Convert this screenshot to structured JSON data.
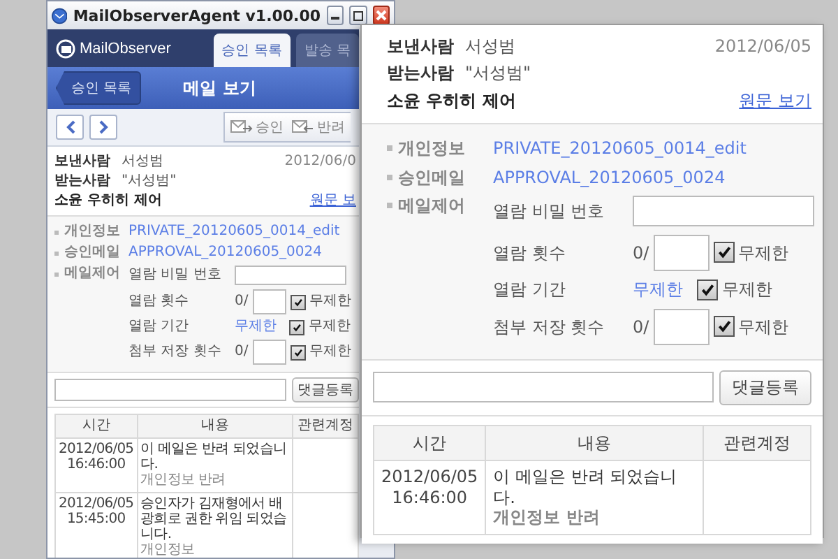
{
  "window": {
    "title": "MailObserverAgent v1.00.00",
    "logo": "MailObserver",
    "tabs": [
      {
        "label": "승인 목록",
        "selected": true
      },
      {
        "label": "발송 목",
        "selected": false
      }
    ],
    "back_button": "승인 목록",
    "page_title": "메일 보기",
    "toolbar": {
      "buttons": [
        {
          "kind": "approve",
          "label": "승인"
        },
        {
          "kind": "reject",
          "label": "반려"
        }
      ]
    },
    "mail": {
      "sender_label": "보낸사람",
      "sender": "서성범",
      "date": "2012/06/0",
      "recipient_label": "받는사람",
      "recipient": "\"서성범\"",
      "subject": "소윤 우히히 제어",
      "original_link": "원문 보",
      "private_label": "개인정보",
      "private_value": "PRIVATE_20120605_0014_edit",
      "approval_label": "승인메일",
      "approval_value": "APPROVAL_20120605_0024",
      "control_label": "메일제어",
      "controls": [
        {
          "kind": "password",
          "label": "열람 비밀 번호"
        },
        {
          "kind": "count",
          "label": "열람 횟수",
          "prefix": "0/",
          "checkbox_label": "무제한",
          "checked": true
        },
        {
          "kind": "period",
          "label": "열람 기간",
          "value": "무제한",
          "checkbox_label": "무제한",
          "checked": true
        },
        {
          "kind": "count",
          "label": "첨부 저장 횟수",
          "prefix": "0/",
          "checkbox_label": "무제한",
          "checked": true
        }
      ],
      "comment_button": "댓글등록",
      "columns": [
        "시간",
        "내용",
        "관련계정"
      ],
      "rows": [
        {
          "date": "2012/06/05",
          "time": "16:46:00",
          "message": "이 메일은 반려 되었습니다.",
          "tag": "개인정보 반려"
        },
        {
          "date": "2012/06/05",
          "time": "15:45:00",
          "message": "승인자가 김재형에서 배광희로 권한 위임 되었습니다.",
          "tag": "개인정보"
        }
      ]
    }
  },
  "callout": {
    "mail": {
      "sender_label": "보낸사람",
      "sender": "서성범",
      "date": "2012/06/05",
      "recipient_label": "받는사람",
      "recipient": "\"서성범\"",
      "subject": "소윤 우히히 제어",
      "original_link": "원문 보기",
      "private_label": "개인정보",
      "private_value": "PRIVATE_20120605_0014_edit",
      "approval_label": "승인메일",
      "approval_value": "APPROVAL_20120605_0024",
      "control_label": "메일제어",
      "controls": [
        {
          "kind": "password",
          "label": "열람 비밀 번호"
        },
        {
          "kind": "count",
          "label": "열람 횟수",
          "prefix": "0/",
          "checkbox_label": "무제한",
          "checked": true
        },
        {
          "kind": "period",
          "label": "열람 기간",
          "value": "무제한",
          "checkbox_label": "무제한",
          "checked": true
        },
        {
          "kind": "count",
          "label": "첨부 저장 횟수",
          "prefix": "0/",
          "checkbox_label": "무제한",
          "checked": true
        }
      ],
      "comment_button": "댓글등록",
      "columns": [
        "시간",
        "내용",
        "관련계정"
      ],
      "rows": [
        {
          "date": "2012/06/05",
          "time": "16:46:00",
          "message": "이 메일은 반려 되었습니다.",
          "tag": "개인정보 반려"
        }
      ]
    }
  }
}
